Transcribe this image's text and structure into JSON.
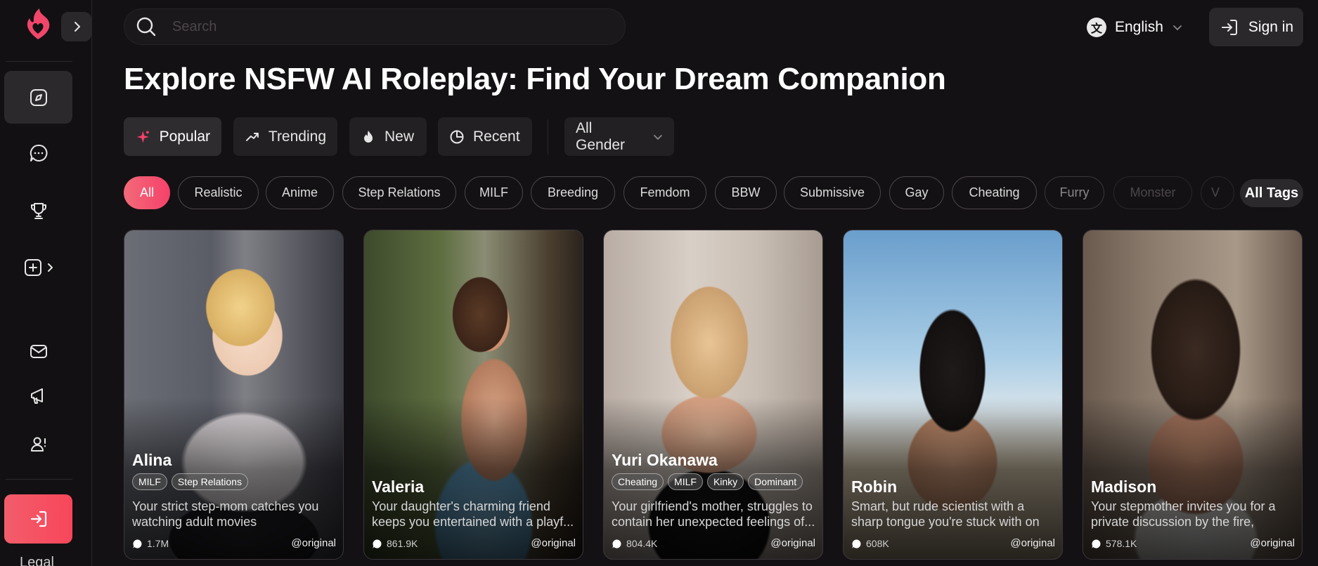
{
  "sidebar": {
    "legal_label": "Legal"
  },
  "search": {
    "placeholder": "Search"
  },
  "header": {
    "language": "English",
    "signin_label": "Sign in"
  },
  "page_title": "Explore NSFW AI Roleplay: Find Your Dream Companion",
  "sort_tabs": [
    {
      "label": "Popular",
      "icon": "sparkle-icon",
      "active": true
    },
    {
      "label": "Trending",
      "icon": "trend-up-icon"
    },
    {
      "label": "New",
      "icon": "flame-icon"
    },
    {
      "label": "Recent",
      "icon": "clock-icon"
    }
  ],
  "gender_filter": {
    "selected": "All Gender"
  },
  "tags": [
    "All",
    "Realistic",
    "Anime",
    "Step Relations",
    "MILF",
    "Breeding",
    "Femdom",
    "BBW",
    "Submissive",
    "Gay",
    "Cheating",
    "Furry",
    "Monster",
    "V"
  ],
  "all_tags_label": "All Tags",
  "cards": [
    {
      "name": "Alina",
      "tags": [
        "MILF",
        "Step Relations"
      ],
      "description": "Your strict step-mom catches you watching adult movies",
      "chats": "1.7M",
      "author": "@original"
    },
    {
      "name": "Valeria",
      "tags": [],
      "description": "Your daughter's charming friend keeps you entertained with a playf...",
      "chats": "861.9K",
      "author": "@original"
    },
    {
      "name": "Yuri Okanawa",
      "tags": [
        "Cheating",
        "MILF",
        "Kinky",
        "Dominant"
      ],
      "description": "Your girlfriend's mother, struggles to contain her unexpected feelings of...",
      "chats": "804.4K",
      "author": "@original"
    },
    {
      "name": "Robin",
      "tags": [],
      "description": "Smart, but rude scientist with a sharp tongue you're stuck with on an...",
      "chats": "608K",
      "author": "@original"
    },
    {
      "name": "Madison",
      "tags": [],
      "description": "Your stepmother invites you for a private discussion by the fire, hintin...",
      "chats": "578.1K",
      "author": "@original"
    }
  ],
  "colors": {
    "background": "#141114",
    "accent": "#f5416a",
    "surface": "#2c292c"
  }
}
